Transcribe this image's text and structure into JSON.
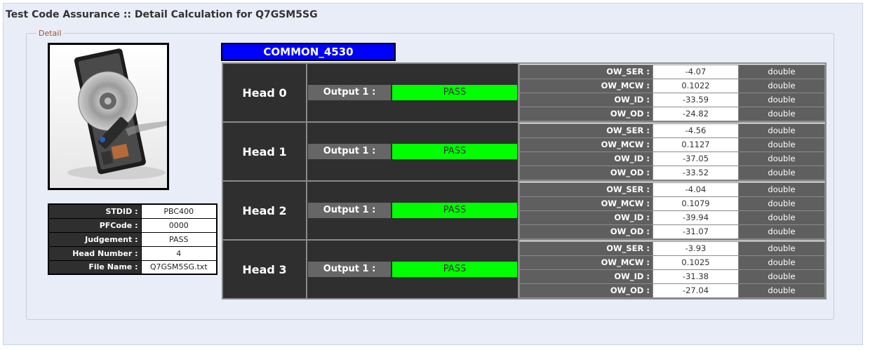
{
  "page": {
    "title": "Test Code Assurance :: Detail Calculation for Q7GSM5SG"
  },
  "detail": {
    "legend": "Detail"
  },
  "image": {
    "alt": "hard-disk-drive"
  },
  "info": [
    {
      "label": "STDID :",
      "value": "PBC400"
    },
    {
      "label": "PFCode :",
      "value": "0000"
    },
    {
      "label": "Judgement :",
      "value": "PASS"
    },
    {
      "label": "Head Number :",
      "value": "4"
    },
    {
      "label": "File Name :",
      "value": "Q7GSM5SG.txt"
    }
  ],
  "common": {
    "title": "COMMON_4530"
  },
  "heads": [
    {
      "name": "Head 0",
      "output_label": "Output 1 :",
      "output_value": "PASS",
      "params": [
        {
          "name": "OW_SER :",
          "value": "-4.07",
          "type": "double"
        },
        {
          "name": "OW_MCW :",
          "value": "0.1022",
          "type": "double"
        },
        {
          "name": "OW_ID :",
          "value": "-33.59",
          "type": "double"
        },
        {
          "name": "OW_OD :",
          "value": "-24.82",
          "type": "double"
        }
      ]
    },
    {
      "name": "Head 1",
      "output_label": "Output 1 :",
      "output_value": "PASS",
      "params": [
        {
          "name": "OW_SER :",
          "value": "-4.56",
          "type": "double"
        },
        {
          "name": "OW_MCW :",
          "value": "0.1127",
          "type": "double"
        },
        {
          "name": "OW_ID :",
          "value": "-37.05",
          "type": "double"
        },
        {
          "name": "OW_OD :",
          "value": "-33.52",
          "type": "double"
        }
      ]
    },
    {
      "name": "Head 2",
      "output_label": "Output 1 :",
      "output_value": "PASS",
      "params": [
        {
          "name": "OW_SER :",
          "value": "-4.04",
          "type": "double"
        },
        {
          "name": "OW_MCW :",
          "value": "0.1079",
          "type": "double"
        },
        {
          "name": "OW_ID :",
          "value": "-39.94",
          "type": "double"
        },
        {
          "name": "OW_OD :",
          "value": "-31.07",
          "type": "double"
        }
      ]
    },
    {
      "name": "Head 3",
      "output_label": "Output 1 :",
      "output_value": "PASS",
      "params": [
        {
          "name": "OW_SER :",
          "value": "-3.93",
          "type": "double"
        },
        {
          "name": "OW_MCW :",
          "value": "0.1025",
          "type": "double"
        },
        {
          "name": "OW_ID :",
          "value": "-31.38",
          "type": "double"
        },
        {
          "name": "OW_OD :",
          "value": "-27.04",
          "type": "double"
        }
      ]
    }
  ],
  "colors": {
    "common_bg": "#0000ff",
    "pass_bg": "#00ff00",
    "dark_cell": "#2f2f2f"
  }
}
